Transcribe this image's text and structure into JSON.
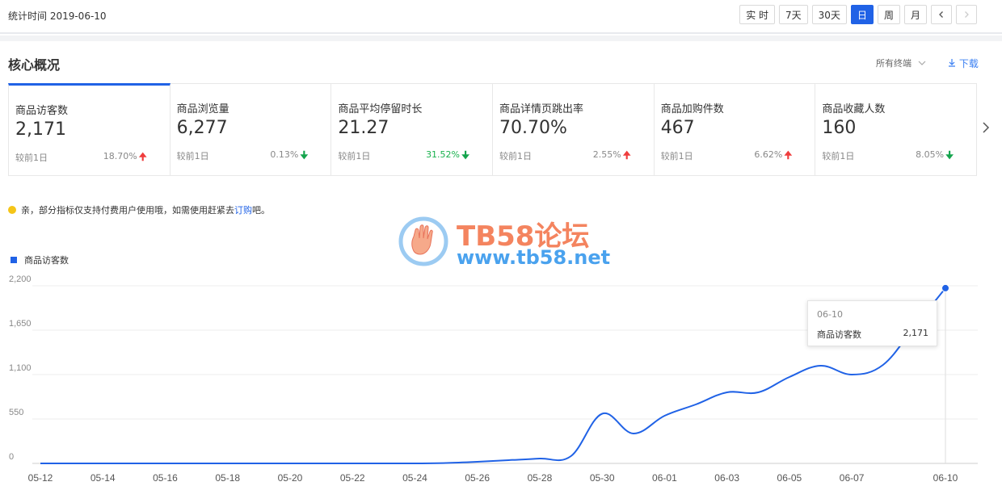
{
  "header": {
    "stat_time": "统计时间 2019-06-10"
  },
  "range_buttons": [
    {
      "label": "实 时",
      "active": false
    },
    {
      "label": "7天",
      "active": false
    },
    {
      "label": "30天",
      "active": false
    },
    {
      "label": "日",
      "active": true
    },
    {
      "label": "周",
      "active": false
    },
    {
      "label": "月",
      "active": false
    }
  ],
  "nav_icons": {
    "prev": "chevron-left-icon",
    "next": "chevron-right-icon"
  },
  "section": {
    "title": "核心概况",
    "terminal": "所有终端",
    "download": "下载"
  },
  "metrics": [
    {
      "label": "商品访客数",
      "value": "2,171",
      "compare_label": "较前1日",
      "change": "18.70%",
      "direction": "up",
      "highlight": false
    },
    {
      "label": "商品浏览量",
      "value": "6,277",
      "compare_label": "较前1日",
      "change": "0.13%",
      "direction": "down",
      "highlight": false
    },
    {
      "label": "商品平均停留时长",
      "value": "21.27",
      "compare_label": "较前1日",
      "change": "31.52%",
      "direction": "down",
      "highlight": true
    },
    {
      "label": "商品详情页跳出率",
      "value": "70.70%",
      "compare_label": "较前1日",
      "change": "2.55%",
      "direction": "up",
      "highlight": false
    },
    {
      "label": "商品加购件数",
      "value": "467",
      "compare_label": "较前1日",
      "change": "6.62%",
      "direction": "up",
      "highlight": false
    },
    {
      "label": "商品收藏人数",
      "value": "160",
      "compare_label": "较前1日",
      "change": "8.05%",
      "direction": "down",
      "highlight": false
    }
  ],
  "notice": {
    "text_before": "亲，部分指标仅支持付费用户使用哦，如需使用赶紧去 ",
    "link": "订购",
    "text_after": "吧。"
  },
  "watermark": {
    "title": "TB58论坛",
    "url": "www.tb58.net"
  },
  "colors": {
    "accent": "#2062e6",
    "up": "#ef3d3d",
    "down": "#14a44d",
    "green_text": "#19b14d",
    "notice_dot": "#f5c518"
  },
  "chart_data": {
    "type": "line",
    "title": "",
    "xlabel": "",
    "ylabel": "",
    "series": [
      {
        "name": "商品访客数",
        "values": [
          0,
          0,
          0,
          0,
          0,
          0,
          0,
          0,
          0,
          0,
          0,
          0,
          0,
          0,
          5,
          20,
          40,
          60,
          90,
          615,
          370,
          590,
          730,
          880,
          880,
          1070,
          1210,
          1100,
          1220,
          1690,
          2171
        ]
      }
    ],
    "x": [
      "05-12",
      "05-13",
      "05-14",
      "05-15",
      "05-16",
      "05-17",
      "05-18",
      "05-19",
      "05-20",
      "05-21",
      "05-22",
      "05-23",
      "05-24",
      "05-25",
      "05-26",
      "05-27",
      "05-28",
      "05-29",
      "05-30",
      "05-31",
      "06-01",
      "06-02",
      "06-03",
      "06-04",
      "06-05",
      "06-06",
      "06-07",
      "06-08",
      "06-09",
      "06-10"
    ],
    "x_tick_labels": [
      "05-12",
      "05-14",
      "05-16",
      "05-18",
      "05-20",
      "05-22",
      "05-24",
      "05-26",
      "05-28",
      "05-30",
      "06-01",
      "06-03",
      "06-05",
      "06-07",
      "06-10"
    ],
    "y_ticks": [
      "0",
      "550",
      "1,100",
      "1,650",
      "2,200"
    ],
    "ylim": [
      0,
      2200
    ],
    "grid": true,
    "legend_position": "top-left",
    "tooltip": {
      "date": "06-10",
      "series": "商品访客数",
      "value": "2,171"
    }
  }
}
